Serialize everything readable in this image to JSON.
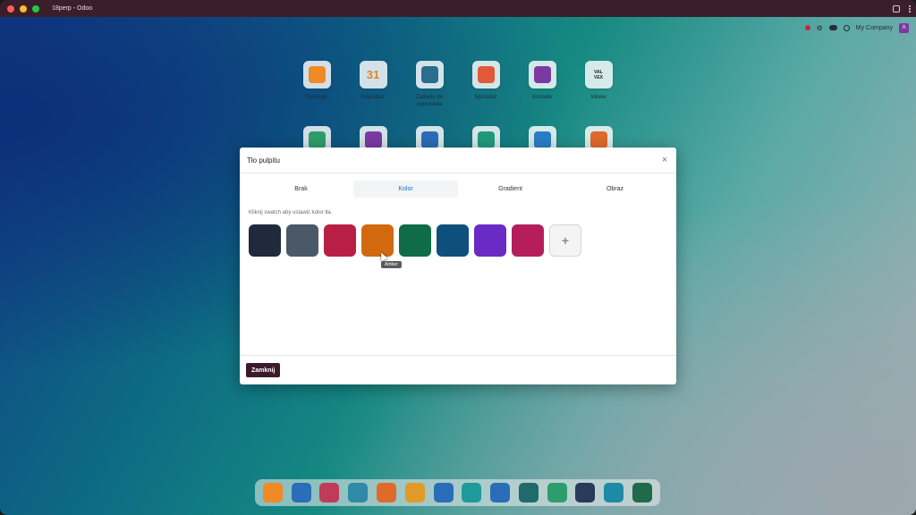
{
  "window": {
    "title": "18perp - Odoo"
  },
  "systray": {
    "company": "My Company",
    "avatar_letter": "A"
  },
  "apps": [
    {
      "label": "Dyskusje",
      "icon": "discuss-icon",
      "color": "#f08a24"
    },
    {
      "label": "Kalendarz",
      "icon": "calendar-icon",
      "color": "#e0862b",
      "text": "31"
    },
    {
      "label": "Zadanie do wykonania",
      "icon": "todo-icon",
      "color": "#2a6d8c"
    },
    {
      "label": "Sprzedaż",
      "icon": "sales-icon",
      "color": "#e05a3a"
    },
    {
      "label": "Konsole",
      "icon": "console-icon",
      "color": "#7a3aa1"
    },
    {
      "label": "Valvex",
      "icon": "valvex-icon",
      "color": "#222222",
      "text": "VAL VEX"
    },
    {
      "label": "",
      "icon": "project-icon",
      "color": "#2e9d6b"
    },
    {
      "label": "",
      "icon": "spreadsheet-icon",
      "color": "#7a3aa1"
    },
    {
      "label": "",
      "icon": "email-marketing-icon",
      "color": "#2a6db8"
    },
    {
      "label": "",
      "icon": "documents-icon",
      "color": "#1f9a7a"
    },
    {
      "label": "",
      "icon": "apps-grid-icon",
      "color": "#2a7ec8"
    },
    {
      "label": "",
      "icon": "inventory-icon",
      "color": "#e06a2a"
    }
  ],
  "dialog": {
    "title": "Tło pulpitu",
    "tabs": [
      {
        "label": "Brak",
        "active": false
      },
      {
        "label": "Kolor",
        "active": true
      },
      {
        "label": "Gradient",
        "active": false
      },
      {
        "label": "Obraz",
        "active": false
      }
    ],
    "hint": "Kliknij swatch aby ustawić kolor tła.",
    "swatches": [
      {
        "name": "slate-dark",
        "color": "#1f2a3c"
      },
      {
        "name": "slate",
        "color": "#4b5868"
      },
      {
        "name": "crimson",
        "color": "#b91f44"
      },
      {
        "name": "amber",
        "color": "#d2690f"
      },
      {
        "name": "emerald",
        "color": "#0f6b4a"
      },
      {
        "name": "ocean",
        "color": "#0f4f7c"
      },
      {
        "name": "violet",
        "color": "#6a2ac4"
      },
      {
        "name": "raspberry",
        "color": "#b51e5a"
      }
    ],
    "add_label": "+",
    "tooltip": "Amber",
    "close_button": "Zamknij"
  },
  "dock": [
    {
      "icon": "discuss-icon",
      "color": "#f08a24"
    },
    {
      "icon": "sign-icon",
      "color": "#2a6db8"
    },
    {
      "icon": "contacts-icon",
      "color": "#c03a5a"
    },
    {
      "icon": "dashboard-icon",
      "color": "#2e8aa8"
    },
    {
      "icon": "inventory-icon",
      "color": "#e06a2a"
    },
    {
      "icon": "employees-icon",
      "color": "#e09a2a"
    },
    {
      "icon": "team-icon",
      "color": "#2a6db8"
    },
    {
      "icon": "discover-icon",
      "color": "#1f9a9a"
    },
    {
      "icon": "link-icon",
      "color": "#2a6db8"
    },
    {
      "icon": "card-icon",
      "color": "#1f6a6a"
    },
    {
      "icon": "reports-icon",
      "color": "#2e9d6b"
    },
    {
      "icon": "elearning-icon",
      "color": "#2a3a5a"
    },
    {
      "icon": "website-icon",
      "color": "#1f8aa8"
    },
    {
      "icon": "badge-icon",
      "color": "#1f6a4a"
    }
  ]
}
